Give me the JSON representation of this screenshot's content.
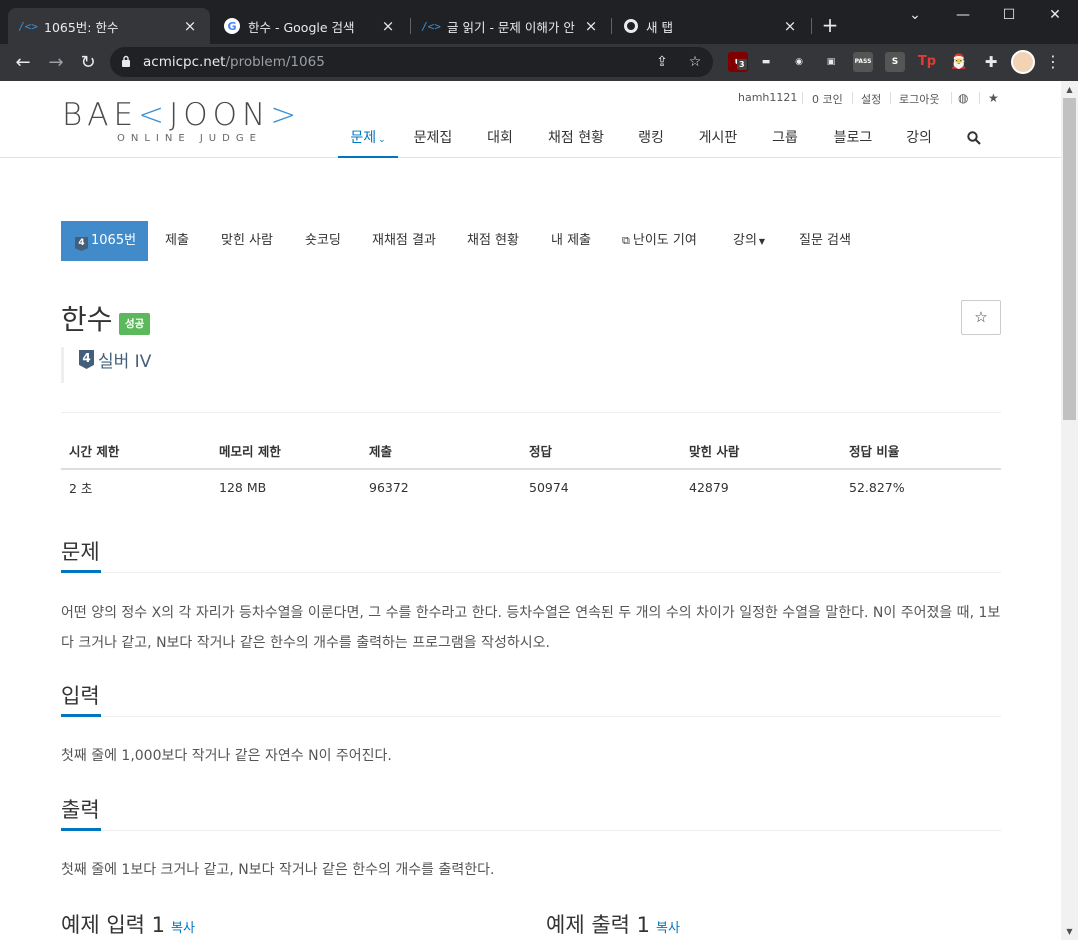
{
  "browser": {
    "tabs": [
      {
        "title": "1065번: 한수",
        "icon": "boj-icon"
      },
      {
        "title": "한수 - Google 검색",
        "icon": "google-icon"
      },
      {
        "title": "글 읽기 - 문제 이해가 안",
        "icon": "boj-icon"
      },
      {
        "title": "새 탭",
        "icon": "chrome-icon"
      }
    ],
    "url_host": "acmicpc.net",
    "url_path": "/problem/1065",
    "ext_ublock_count": "3",
    "window_controls": {
      "minimize": "—",
      "maximize": "☐",
      "close": "✕"
    }
  },
  "site": {
    "logo_text_left": "BAE",
    "logo_text_bracket1": "<",
    "logo_text_mid": "JOON",
    "logo_text_bracket2": ">",
    "logo_subtitle": "ONLINE JUDGE",
    "top_links": [
      "hamh1121",
      "0 코인",
      "설정",
      "로그아웃"
    ],
    "main_nav": [
      "문제",
      "문제집",
      "대회",
      "채점 현황",
      "랭킹",
      "게시판",
      "그룹",
      "블로그",
      "강의"
    ]
  },
  "problem_nav": {
    "active_label": "1065번",
    "active_tier": "4",
    "items": [
      "제출",
      "맞힌 사람",
      "숏코딩",
      "재채점 결과",
      "채점 현황",
      "내 제출",
      "난이도 기여",
      "강의",
      "질문 검색"
    ]
  },
  "problem": {
    "title": "한수",
    "status_label": "성공",
    "tier_number": "4",
    "tier_text": "실버 IV",
    "stats_headers": [
      "시간 제한",
      "메모리 제한",
      "제출",
      "정답",
      "맞힌 사람",
      "정답 비율"
    ],
    "stats_values": [
      "2 초",
      "128 MB",
      "96372",
      "50974",
      "42879",
      "52.827%"
    ],
    "sections": {
      "description_title": "문제",
      "description_body": "어떤 양의 정수 X의 각 자리가 등차수열을 이룬다면, 그 수를 한수라고 한다. 등차수열은 연속된 두 개의 수의 차이가 일정한 수열을 말한다. N이 주어졌을 때, 1보다 크거나 같고, N보다 작거나 같은 한수의 개수를 출력하는 프로그램을 작성하시오.",
      "input_title": "입력",
      "input_body": "첫째 줄에 1,000보다 작거나 같은 자연수 N이 주어진다.",
      "output_title": "출력",
      "output_body": "첫째 줄에 1보다 크거나 같고, N보다 작거나 같은 한수의 개수를 출력한다.",
      "sample_input_title": "예제 입력 1",
      "sample_output_title": "예제 출력 1",
      "copy_label": "복사"
    }
  },
  "colors": {
    "accent": "#0076c0",
    "active_tab_bg": "#428bca",
    "success": "#5cb85c",
    "silver_tier": "#435f7a"
  }
}
